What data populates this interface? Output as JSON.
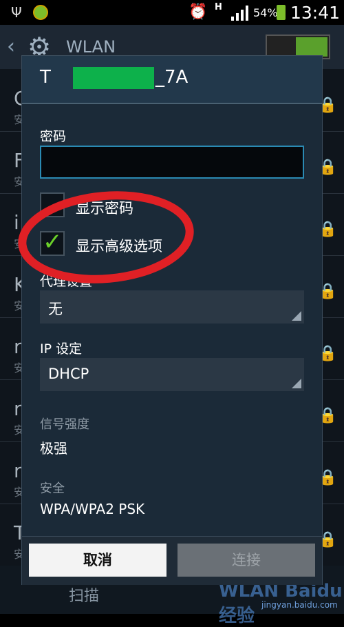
{
  "status": {
    "battery_pct": "54%",
    "time": "13:41",
    "net_type": "H"
  },
  "appbar": {
    "title": "WLAN"
  },
  "background_rows": [
    {
      "initial": "C",
      "sub": "安"
    },
    {
      "initial": "F",
      "sub": "安"
    },
    {
      "initial": "i",
      "sub": "安"
    },
    {
      "initial": "K",
      "sub": "安"
    },
    {
      "initial": "n",
      "sub": "安"
    },
    {
      "initial": "n",
      "sub": "安"
    },
    {
      "initial": "n",
      "sub": "安"
    },
    {
      "initial": "T",
      "sub": "安"
    }
  ],
  "bottombar": {
    "scan_label": "扫描",
    "watermark": "WLAN Baidu经验",
    "watermark_url": "jingyan.baidu.com"
  },
  "dialog": {
    "title_prefix": "T",
    "title_suffix": "_7A",
    "password_label": "密码",
    "password_value": "",
    "show_password_label": "显示密码",
    "show_password_checked": false,
    "advanced_label": "显示高级选项",
    "advanced_checked": true,
    "proxy_label": "代理设置",
    "proxy_value": "无",
    "ip_label": "IP 设定",
    "ip_value": "DHCP",
    "signal_label": "信号强度",
    "signal_value": "极强",
    "security_label": "安全",
    "security_value": "WPA/WPA2 PSK",
    "cancel_label": "取消",
    "connect_label": "连接"
  },
  "colors": {
    "dialog_bg": "#1b2a38",
    "input_border": "#2a8ab3",
    "check_green": "#6bd12a",
    "annotation_red": "#e02025",
    "redaction_green": "#0db14b"
  }
}
